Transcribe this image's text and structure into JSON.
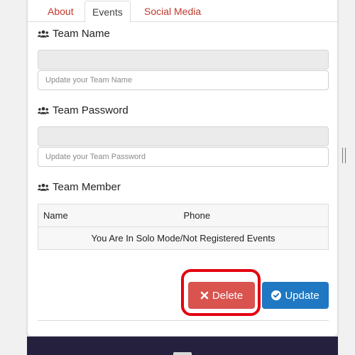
{
  "tabs": [
    {
      "label": "About",
      "active": false
    },
    {
      "label": "Events",
      "active": true
    },
    {
      "label": "Social Media",
      "active": false
    }
  ],
  "team_name": {
    "title": "Team Name",
    "current_value": "",
    "placeholder": "Update your Team Name"
  },
  "team_password": {
    "title": "Team Password",
    "current_value": "",
    "placeholder": "Update your Team Password"
  },
  "team_member": {
    "title": "Team Member",
    "columns": [
      "Name",
      "Phone"
    ],
    "empty_message": "You Are In Solo Mode/Not Registered Events"
  },
  "actions": {
    "delete_label": "Delete",
    "update_label": "Update"
  },
  "colors": {
    "tab_link": "#c0392b",
    "delete_button": "#d9534f",
    "update_button": "#1f78c1",
    "highlight_ring": "#e4000f",
    "footer": "#26203f"
  },
  "icons": {
    "section": "users-icon",
    "delete": "times-icon",
    "update": "check-circle-icon"
  }
}
